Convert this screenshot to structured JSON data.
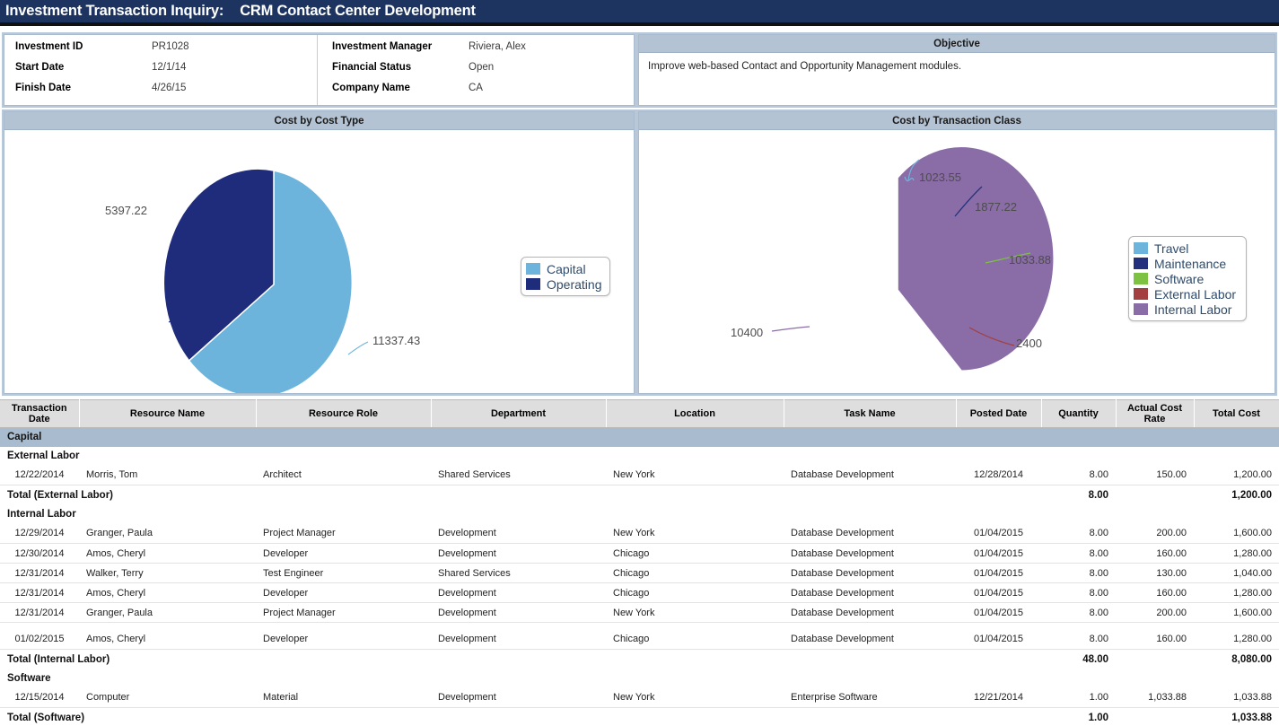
{
  "titlebar": {
    "label": "Investment Transaction Inquiry:",
    "investment": "CRM Contact Center Development"
  },
  "info": {
    "left": [
      {
        "label": "Investment ID",
        "value": "PR1028"
      },
      {
        "label": "Start Date",
        "value": "12/1/14"
      },
      {
        "label": "Finish Date",
        "value": "4/26/15"
      }
    ],
    "right": [
      {
        "label": "Investment Manager",
        "value": "Riviera, Alex"
      },
      {
        "label": "Financial Status",
        "value": "Open"
      },
      {
        "label": "Company Name",
        "value": "CA"
      }
    ]
  },
  "objective": {
    "title": "Objective",
    "text": "Improve web-based Contact and Opportunity Management modules."
  },
  "chart_data": [
    {
      "type": "pie",
      "title": "Cost by Cost Type",
      "categories": [
        "Capital",
        "Operating"
      ],
      "values": [
        11337.43,
        5397.22
      ],
      "labels": [
        "11337.43",
        "5397.22"
      ],
      "colors": [
        "#6cb4dc",
        "#1f2c7c"
      ],
      "legend_position": "right",
      "legend": [
        "Capital",
        "Operating"
      ]
    },
    {
      "type": "pie",
      "title": "Cost by Transaction Class",
      "categories": [
        "Travel",
        "Maintenance",
        "Software",
        "External Labor",
        "Internal Labor"
      ],
      "values": [
        1023.55,
        1877.22,
        1033.88,
        2400,
        10400
      ],
      "labels": [
        "1023.55",
        "1877.22",
        "1033.88",
        "2400",
        "10400"
      ],
      "colors": [
        "#6cb4dc",
        "#22307e",
        "#7dc242",
        "#a33f3f",
        "#8a6ca6"
      ],
      "legend_position": "right",
      "legend": [
        "Travel",
        "Maintenance",
        "Software",
        "External Labor",
        "Internal Labor"
      ]
    }
  ],
  "table": {
    "columns": [
      "Transaction Date",
      "Resource Name",
      "Resource Role",
      "Department",
      "Location",
      "Task Name",
      "Posted Date",
      "Quantity",
      "Actual Cost Rate",
      "Total Cost"
    ],
    "rows": [
      {
        "kind": "group",
        "label": "Capital"
      },
      {
        "kind": "sub",
        "label": "External Labor"
      },
      {
        "kind": "data",
        "cells": [
          "12/22/2014",
          "Morris, Tom",
          "Architect",
          "Shared Services",
          "New York",
          "Database Development",
          "12/28/2014",
          "8.00",
          "150.00",
          "1,200.00"
        ]
      },
      {
        "kind": "total",
        "label": "Total (External Labor)",
        "quantity": "8.00",
        "rate": "",
        "total": "1,200.00"
      },
      {
        "kind": "sub",
        "label": "Internal Labor"
      },
      {
        "kind": "data",
        "cells": [
          "12/29/2014",
          "Granger, Paula",
          "Project Manager",
          "Development",
          "New York",
          "Database Development",
          "01/04/2015",
          "8.00",
          "200.00",
          "1,600.00"
        ]
      },
      {
        "kind": "data",
        "cells": [
          "12/30/2014",
          "Amos, Cheryl",
          "Developer",
          "Development",
          "Chicago",
          "Database Development",
          "01/04/2015",
          "8.00",
          "160.00",
          "1,280.00"
        ]
      },
      {
        "kind": "data",
        "cells": [
          "12/31/2014",
          "Walker, Terry",
          "Test Engineer",
          "Shared Services",
          "Chicago",
          "Database Development",
          "01/04/2015",
          "8.00",
          "130.00",
          "1,040.00"
        ]
      },
      {
        "kind": "data",
        "cells": [
          "12/31/2014",
          "Amos, Cheryl",
          "Developer",
          "Development",
          "Chicago",
          "Database Development",
          "01/04/2015",
          "8.00",
          "160.00",
          "1,280.00"
        ]
      },
      {
        "kind": "data",
        "cells": [
          "12/31/2014",
          "Granger, Paula",
          "Project Manager",
          "Development",
          "New York",
          "Database Development",
          "01/04/2015",
          "8.00",
          "200.00",
          "1,600.00"
        ]
      },
      {
        "kind": "spacer"
      },
      {
        "kind": "data",
        "cells": [
          "01/02/2015",
          "Amos, Cheryl",
          "Developer",
          "Development",
          "Chicago",
          "Database Development",
          "01/04/2015",
          "8.00",
          "160.00",
          "1,280.00"
        ]
      },
      {
        "kind": "total",
        "label": "Total (Internal Labor)",
        "quantity": "48.00",
        "rate": "",
        "total": "8,080.00"
      },
      {
        "kind": "sub",
        "label": "Software"
      },
      {
        "kind": "data",
        "cells": [
          "12/15/2014",
          "Computer",
          "Material",
          "Development",
          "New York",
          "Enterprise Software",
          "12/21/2014",
          "1.00",
          "1,033.88",
          "1,033.88"
        ]
      },
      {
        "kind": "total",
        "label": "Total (Software)",
        "quantity": "1.00",
        "rate": "",
        "total": "1,033.88"
      }
    ]
  }
}
